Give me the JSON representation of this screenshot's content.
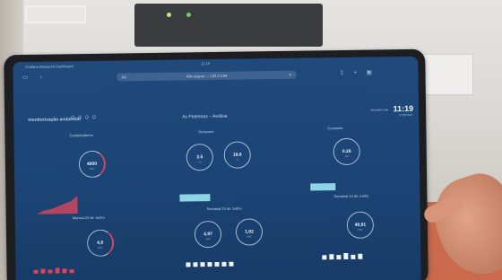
{
  "browser": {
    "app_name": "Grafana Research Dashboard",
    "time": "11:19",
    "url_hint": "AA",
    "url": "Não seguro — 192.0.2.86",
    "reload_icon": "reload-icon"
  },
  "dashboard": {
    "brand": "monitorização ambiental",
    "title": "As Pedreiras – Análise",
    "clock": "11:19",
    "date": "17.06.2021",
    "user": "Secretária sala",
    "tabs": [
      "Q",
      "Q",
      "Q",
      "Q"
    ]
  },
  "sections": {
    "left": "Computadores",
    "middle": "Sensores",
    "right": "Consumo",
    "left_chart": "Mensal 24 de Junho",
    "middle_chart": "Semanal 24 de Junho",
    "right_chart": "Semanal 24 de Junho"
  },
  "gauges": {
    "g1": {
      "value": "4000",
      "unit": "kWh"
    },
    "g2": {
      "value": "2.5",
      "unit": "m³"
    },
    "g3": {
      "value": "18.6",
      "unit": "°C"
    },
    "g4": {
      "value": "0.26",
      "unit": "kW"
    },
    "g5": {
      "value": "4,9",
      "unit": "kWh"
    },
    "g6": {
      "value": "4,97",
      "unit": "kWh"
    },
    "g7": {
      "value": "1,02",
      "unit": "kWh"
    },
    "g8": {
      "value": "48,91",
      "unit": "kWh"
    }
  },
  "colors": {
    "screen": "#1c4577",
    "accent_red": "#d9465c",
    "accent_cyan": "#8fd3e6"
  }
}
